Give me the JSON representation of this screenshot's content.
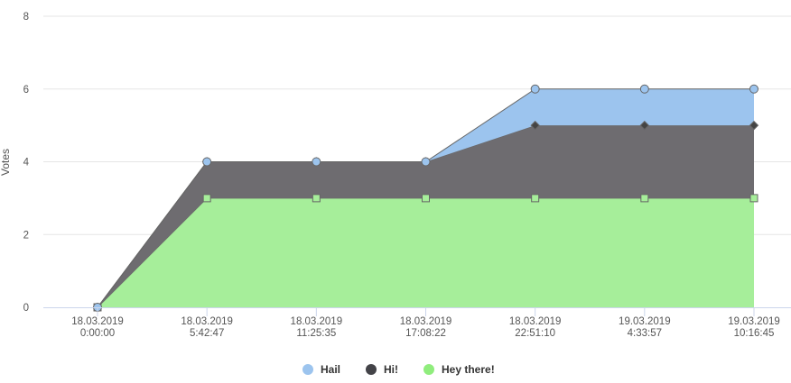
{
  "chart_data": {
    "type": "area",
    "stacked": true,
    "ylabel": "Votes",
    "ylim": [
      0,
      8
    ],
    "yticks": [
      0,
      2,
      4,
      6,
      8
    ],
    "grid": true,
    "legend_position": "bottom-center",
    "categories": [
      [
        "18.03.2019",
        "0:00:00"
      ],
      [
        "18.03.2019",
        "5:42:47"
      ],
      [
        "18.03.2019",
        "11:25:35"
      ],
      [
        "18.03.2019",
        "17:08:22"
      ],
      [
        "18.03.2019",
        "22:51:10"
      ],
      [
        "19.03.2019",
        "4:33:57"
      ],
      [
        "19.03.2019",
        "10:16:45"
      ]
    ],
    "series": [
      {
        "name": "Hail",
        "color": "#9cc4ee",
        "marker": "circle",
        "values": [
          0,
          0,
          0,
          0,
          1,
          1,
          1
        ]
      },
      {
        "name": "Hi!",
        "color": "#6e6c70",
        "legend_color": "#434348",
        "marker": "diamond",
        "values": [
          0,
          1,
          1,
          1,
          2,
          2,
          2
        ]
      },
      {
        "name": "Hey there!",
        "color": "#a6ee9a",
        "legend_color": "#90ed7d",
        "marker": "square",
        "values": [
          0,
          3,
          3,
          3,
          3,
          3,
          3
        ]
      }
    ]
  }
}
